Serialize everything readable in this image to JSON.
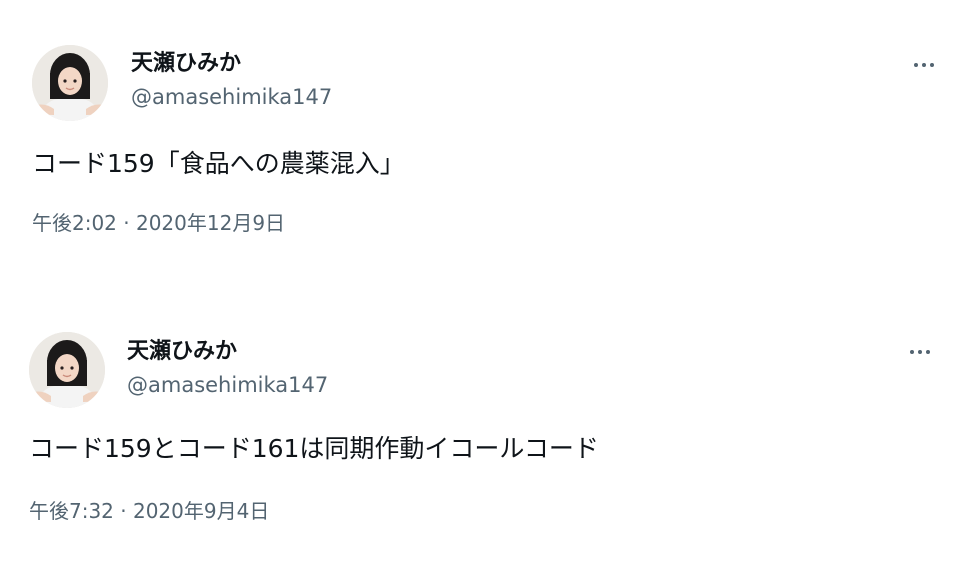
{
  "tweets": [
    {
      "display_name": "天瀬ひみか",
      "handle": "@amasehimika147",
      "text": "コード159「食品への農薬混入」",
      "timestamp": "午後2:02 · 2020年12月9日",
      "avatar_icon": "profile-photo",
      "more_icon": "more-options-icon"
    },
    {
      "display_name": "天瀬ひみか",
      "handle": "@amasehimika147",
      "text": "コード159とコード161は同期作動イコールコード",
      "timestamp": "午後7:32 · 2020年9月4日",
      "avatar_icon": "profile-photo",
      "more_icon": "more-options-icon"
    }
  ],
  "colors": {
    "text_primary": "#0f1419",
    "text_secondary": "#536471",
    "background": "#ffffff"
  }
}
